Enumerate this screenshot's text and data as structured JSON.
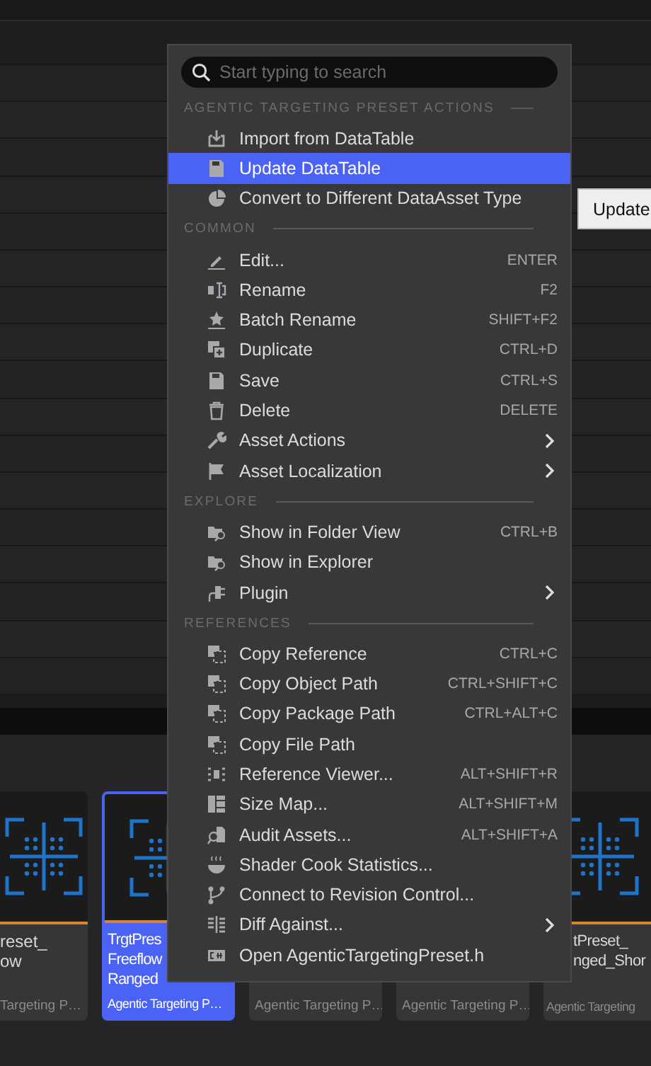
{
  "search": {
    "placeholder": "Start typing to search"
  },
  "menu": {
    "sections": [
      {
        "title": "AGENTIC TARGETING PRESET ACTIONS",
        "items": [
          {
            "label": "Import from DataTable",
            "selected": false,
            "submenu": false
          },
          {
            "label": "Update DataTable",
            "selected": true,
            "submenu": false
          },
          {
            "label": "Convert to Different DataAsset Type",
            "selected": false,
            "submenu": false
          }
        ]
      },
      {
        "title": "COMMON",
        "items": [
          {
            "label": "Edit...",
            "shortcut": "ENTER",
            "selected": false,
            "submenu": false
          },
          {
            "label": "Rename",
            "shortcut": "F2",
            "selected": false,
            "submenu": false
          },
          {
            "label": "Batch Rename",
            "shortcut": "SHIFT+F2",
            "selected": false,
            "submenu": false
          },
          {
            "label": "Duplicate",
            "shortcut": "CTRL+D",
            "selected": false,
            "submenu": false
          },
          {
            "label": "Save",
            "shortcut": "CTRL+S",
            "selected": false,
            "submenu": false
          },
          {
            "label": "Delete",
            "shortcut": "DELETE",
            "selected": false,
            "submenu": false
          },
          {
            "label": "Asset Actions",
            "selected": false,
            "submenu": true
          },
          {
            "label": "Asset Localization",
            "selected": false,
            "submenu": true
          }
        ]
      },
      {
        "title": "EXPLORE",
        "items": [
          {
            "label": "Show in Folder View",
            "shortcut": "CTRL+B",
            "selected": false,
            "submenu": false
          },
          {
            "label": "Show in Explorer",
            "selected": false,
            "submenu": false
          },
          {
            "label": "Plugin",
            "selected": false,
            "submenu": true
          }
        ]
      },
      {
        "title": "REFERENCES",
        "items": [
          {
            "label": "Copy Reference",
            "shortcut": "CTRL+C",
            "selected": false,
            "submenu": false
          },
          {
            "label": "Copy Object Path",
            "shortcut": "CTRL+SHIFT+C",
            "selected": false,
            "submenu": false
          },
          {
            "label": "Copy Package Path",
            "shortcut": "CTRL+ALT+C",
            "selected": false,
            "submenu": false
          },
          {
            "label": "Copy File Path",
            "selected": false,
            "submenu": false
          },
          {
            "label": "Reference Viewer...",
            "shortcut": "ALT+SHIFT+R",
            "selected": false,
            "submenu": false
          },
          {
            "label": "Size Map...",
            "shortcut": "ALT+SHIFT+M",
            "selected": false,
            "submenu": false
          },
          {
            "label": "Audit Assets...",
            "shortcut": "ALT+SHIFT+A",
            "selected": false,
            "submenu": false
          },
          {
            "label": "Shader Cook Statistics...",
            "selected": false,
            "submenu": false
          },
          {
            "label": "Connect to Revision Control...",
            "selected": false,
            "submenu": false
          },
          {
            "label": "Diff Against...",
            "selected": false,
            "submenu": true
          },
          {
            "label": "Open AgenticTargetingPreset.h",
            "selected": false,
            "submenu": false
          }
        ]
      }
    ]
  },
  "tooltip": {
    "text": "Update"
  },
  "tiles": [
    {
      "lines": [
        "reset_",
        "ow"
      ],
      "caption": "Targeting P…",
      "selected": false
    },
    {
      "lines": [
        "TrgtPres",
        "Freeflow",
        "Ranged"
      ],
      "caption": "Agentic Targeting P…",
      "selected": true
    },
    {
      "caption": "Agentic Targeting P…",
      "selected": false
    },
    {
      "caption": "Agentic Targeting P…",
      "selected": false
    },
    {
      "lines": [
        "tPreset_",
        "nged_Shor"
      ],
      "caption": "Agentic Targeting",
      "selected": false
    }
  ]
}
